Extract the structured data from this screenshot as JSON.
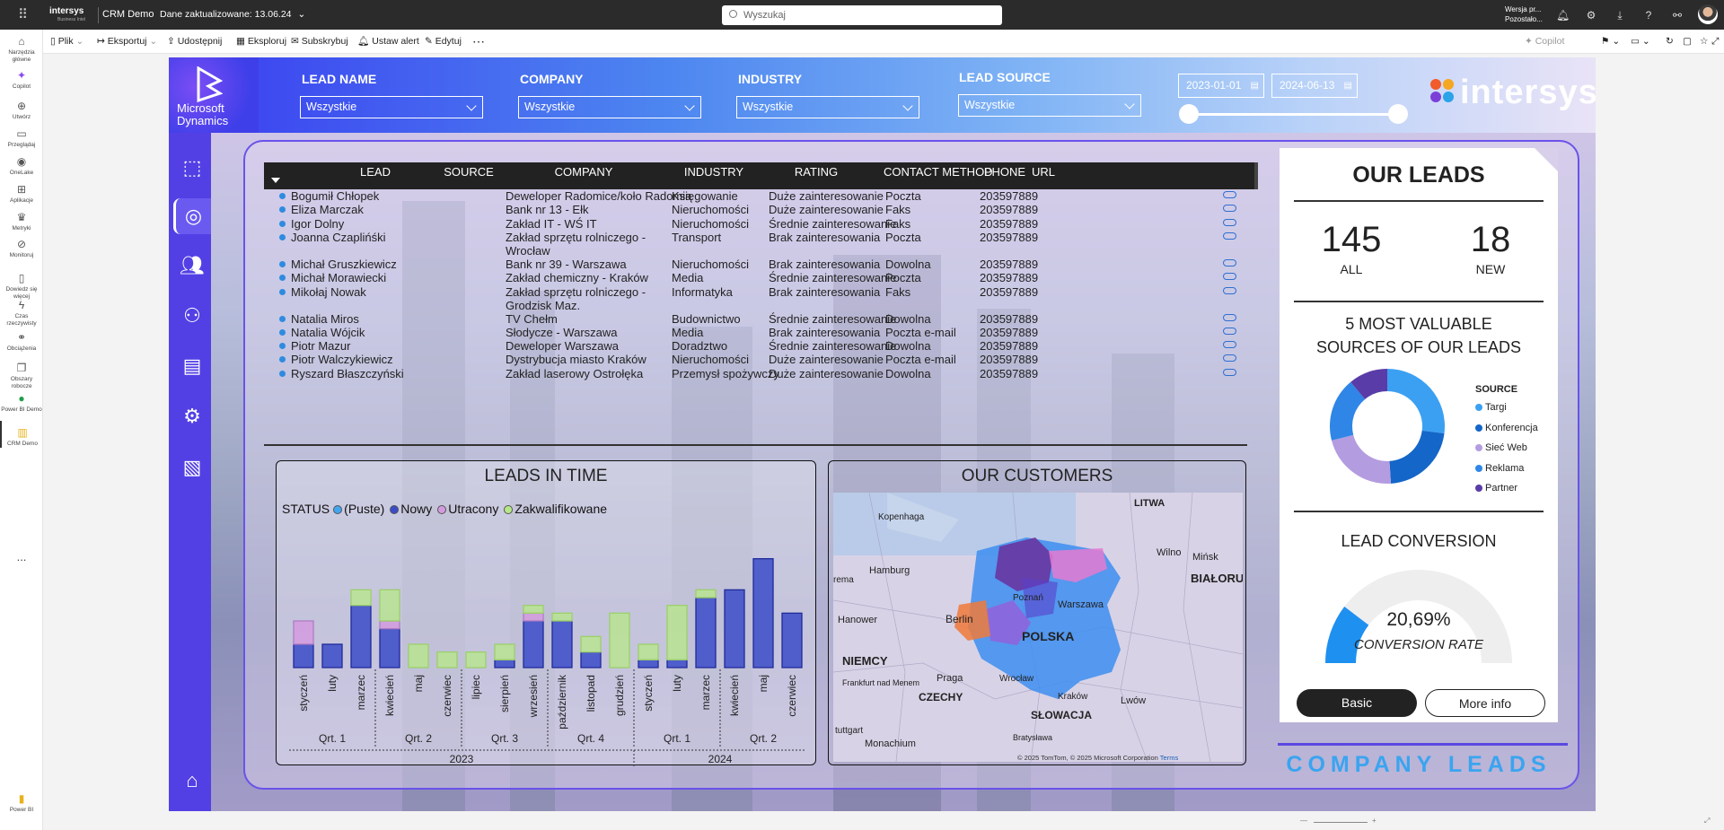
{
  "topbar": {
    "brand": "intersys",
    "brand_sub": "Business Intel",
    "app": "CRM Demo",
    "updated": "Dane zaktualizowane: 13.06.24",
    "search_placeholder": "Wyszukaj",
    "user_line1": "Wersja pr...",
    "user_line2": "Pozostało..."
  },
  "toolbar": {
    "file": "Plik",
    "export": "Eksportuj",
    "share": "Udostępnij",
    "explore": "Eksploruj",
    "subscribe": "Subskrybuj",
    "alert": "Ustaw alert",
    "edit": "Edytuj",
    "more": "⋯",
    "copilot": "Copilot"
  },
  "leftnav": [
    {
      "label": "Narzędzia główne",
      "icon": "⌂"
    },
    {
      "label": "Copilot",
      "icon": "✦"
    },
    {
      "label": "Utwórz",
      "icon": "⊕"
    },
    {
      "label": "Przeglądaj",
      "icon": "▭"
    },
    {
      "label": "OneLake",
      "icon": "◉"
    },
    {
      "label": "Aplikacje",
      "icon": "⊞"
    },
    {
      "label": "Metryki",
      "icon": "♛"
    },
    {
      "label": "Monitoruj",
      "icon": "⊘"
    },
    {
      "label": "Dowiedz się więcej",
      "icon": "▯"
    },
    {
      "label": "Czas rzeczywisty",
      "icon": "ϟ"
    },
    {
      "label": "Obciążenia",
      "icon": "⚭"
    },
    {
      "label": "Obszary robocze",
      "icon": "❐"
    },
    {
      "label": "Power BI Demo",
      "icon": "●"
    },
    {
      "label": "CRM Demo",
      "icon": "▥"
    }
  ],
  "leftnav_more": "...",
  "leftnav_bottom": "Power BI",
  "report": {
    "ms_logo_line1": "Microsoft",
    "ms_logo_line2": "Dynamics",
    "filters": [
      {
        "label": "LEAD NAME",
        "value": "Wszystkie"
      },
      {
        "label": "COMPANY",
        "value": "Wszystkie"
      },
      {
        "label": "INDUSTRY",
        "value": "Wszystkie"
      },
      {
        "label": "LEAD SOURCE",
        "value": "Wszystkie"
      }
    ],
    "date_from": "2023-01-01",
    "date_to": "2024-06-13",
    "brand": "intersys",
    "columns": [
      "LEAD",
      "SOURCE",
      "COMPANY",
      "INDUSTRY",
      "RATING",
      "CONTACT METHOD",
      "PHONE",
      "URL"
    ],
    "rows": [
      {
        "lead": "Bogumił Chłopek",
        "company": "Deweloper Radomice/koło Radomia",
        "company2": "",
        "industry": "Księgowanie",
        "rating": "Duże zainteresowanie",
        "contact": "Poczta",
        "phone": "203597889"
      },
      {
        "lead": "Eliza Marczak",
        "company": "Bank nr 13 - Ełk",
        "company2": "",
        "industry": "Nieruchomości",
        "rating": "Duże zainteresowanie",
        "contact": "Faks",
        "phone": "203597889"
      },
      {
        "lead": "Igor Dolny",
        "company": "Zakład IT - WŚ IT",
        "company2": "",
        "industry": "Nieruchomości",
        "rating": "Średnie zainteresowanie",
        "contact": "Faks",
        "phone": "203597889"
      },
      {
        "lead": "Joanna Czaplińśki",
        "company": "Zakład sprzętu rolniczego -",
        "company2": "Wrocław",
        "industry": "Transport",
        "rating": "Brak zainteresowania",
        "contact": "Poczta",
        "phone": "203597889"
      },
      {
        "lead": "Michał Gruszkiewicz",
        "company": "Bank nr 39 - Warszawa",
        "company2": "",
        "industry": "Nieruchomości",
        "rating": "Brak zainteresowania",
        "contact": "Dowolna",
        "phone": "203597889"
      },
      {
        "lead": "Michał Morawiecki",
        "company": "Zakład chemiczny - Kraków",
        "company2": "",
        "industry": "Media",
        "rating": "Średnie zainteresowanie",
        "contact": "Poczta",
        "phone": "203597889"
      },
      {
        "lead": "Mikołaj Nowak",
        "company": "Zakład sprzętu rolniczego -",
        "company2": "Grodzisk Maz.",
        "industry": "Informatyka",
        "rating": "Brak zainteresowania",
        "contact": "Faks",
        "phone": "203597889"
      },
      {
        "lead": "Natalia Miros",
        "company": "TV Chełm",
        "company2": "",
        "industry": "Budownictwo",
        "rating": "Średnie zainteresowanie",
        "contact": "Dowolna",
        "phone": "203597889"
      },
      {
        "lead": "Natalia Wójcik",
        "company": "Słodycze - Warszawa",
        "company2": "",
        "industry": "Media",
        "rating": "Brak zainteresowania",
        "contact": "Poczta e-mail",
        "phone": "203597889"
      },
      {
        "lead": "Piotr Mazur",
        "company": "Deweloper Warszawa",
        "company2": "",
        "industry": "Doradztwo",
        "rating": "Średnie zainteresowanie",
        "contact": "Dowolna",
        "phone": "203597889"
      },
      {
        "lead": "Piotr Walczykiewicz",
        "company": "Dystrybucja miasto Kraków",
        "company2": "",
        "industry": "Nieruchomości",
        "rating": "Duże zainteresowanie",
        "contact": "Poczta e-mail",
        "phone": "203597889"
      },
      {
        "lead": "Ryszard Błaszczyński",
        "company": "Zakład laserowy Ostrołęka",
        "company2": "",
        "industry": "Przemysł spożywczy",
        "rating": "Duże zainteresowanie",
        "contact": "Dowolna",
        "phone": "203597889"
      }
    ],
    "leads_in_time_title": "LEADS IN TIME",
    "customers_title": "OUR CUSTOMERS",
    "map_labels": [
      "Kopenhaga",
      "LITWA",
      "Wilno",
      "Mińsk",
      "BIAŁORUŚ",
      "Hamburg",
      "rema",
      "Poznań",
      "Warszawa",
      "Berlin",
      "POLSKA",
      "Hanower",
      "NIEMCY",
      "Wrocław",
      "Frankfurt nad Menem",
      "Praga",
      "CZECHY",
      "Kraków",
      "Lwów",
      "SŁOWACJA",
      "tuttgart",
      "Monachium",
      "Bratysława"
    ],
    "map_attribution": "© 2025 TomTom, © 2025 Microsoft Corporation",
    "map_terms": "Terms",
    "our_leads_title": "OUR LEADS",
    "all_count": "145",
    "all_label": "ALL",
    "new_count": "18",
    "new_label": "NEW",
    "sources_title_1": "5 MOST VALUABLE",
    "sources_title_2": "SOURCES OF OUR LEADS",
    "conversion_title": "LEAD CONVERSION",
    "conversion_rate": "20,69%",
    "conversion_label": "CONVERSION RATE",
    "btn_basic": "Basic",
    "btn_more": "More info",
    "company_leads": "COMPANY LEADS"
  },
  "chart_data": [
    {
      "type": "bar",
      "title": "LEADS IN TIME",
      "legend_title": "STATUS",
      "categories": [
        "styczeń",
        "luty",
        "marzec",
        "kwiecień",
        "maj",
        "czerwiec",
        "lipiec",
        "sierpień",
        "wrzesień",
        "październik",
        "listopad",
        "grudzień",
        "styczeń",
        "luty",
        "marzec",
        "kwiecień",
        "maj",
        "czerwiec"
      ],
      "quarters": [
        {
          "label": "Qrt. 1",
          "span": 3
        },
        {
          "label": "Qrt. 2",
          "span": 3
        },
        {
          "label": "Qrt. 3",
          "span": 3
        },
        {
          "label": "Qrt. 4",
          "span": 3
        },
        {
          "label": "Qrt. 1",
          "span": 3
        },
        {
          "label": "Qrt. 2",
          "span": 3
        }
      ],
      "years": [
        {
          "label": "2023",
          "span": 12
        },
        {
          "label": "2024",
          "span": 6
        }
      ],
      "series": [
        {
          "name": "(Puste)",
          "color": "#41a6f0",
          "values": [
            0,
            0,
            0,
            0,
            0,
            0,
            0,
            0,
            0,
            0,
            0,
            0,
            0,
            0,
            0,
            0,
            0,
            0
          ]
        },
        {
          "name": "Nowy",
          "color": "#3b4cc8",
          "values": [
            3,
            3,
            8,
            5,
            0,
            0,
            0,
            1,
            6,
            6,
            2,
            0,
            1,
            1,
            9,
            10,
            14,
            7
          ]
        },
        {
          "name": "Utracony",
          "color": "#d39bdf",
          "values": [
            3,
            0,
            0,
            1,
            0,
            0,
            0,
            0,
            1,
            0,
            0,
            0,
            0,
            0,
            0,
            0,
            0,
            0
          ]
        },
        {
          "name": "Zakwalifikowane",
          "color": "#b7e887",
          "values": [
            0,
            0,
            2,
            4,
            3,
            2,
            2,
            2,
            1,
            1,
            2,
            7,
            2,
            7,
            1,
            0,
            0,
            0
          ]
        }
      ]
    },
    {
      "type": "pie",
      "title": "5 MOST VALUABLE SOURCES OF OUR LEADS",
      "legend_title": "SOURCE",
      "labels": [
        "Targi",
        "Konferencja",
        "Sieć Web",
        "Reklama",
        "Partner"
      ],
      "values": [
        27,
        22,
        22,
        18,
        11
      ],
      "colors": [
        "#3ba0f2",
        "#1466c8",
        "#b49ce0",
        "#2f86e6",
        "#5a3ca8"
      ]
    },
    {
      "type": "gauge",
      "title": "LEAD CONVERSION",
      "value": 20.69,
      "max": 100,
      "unit": "%"
    }
  ]
}
